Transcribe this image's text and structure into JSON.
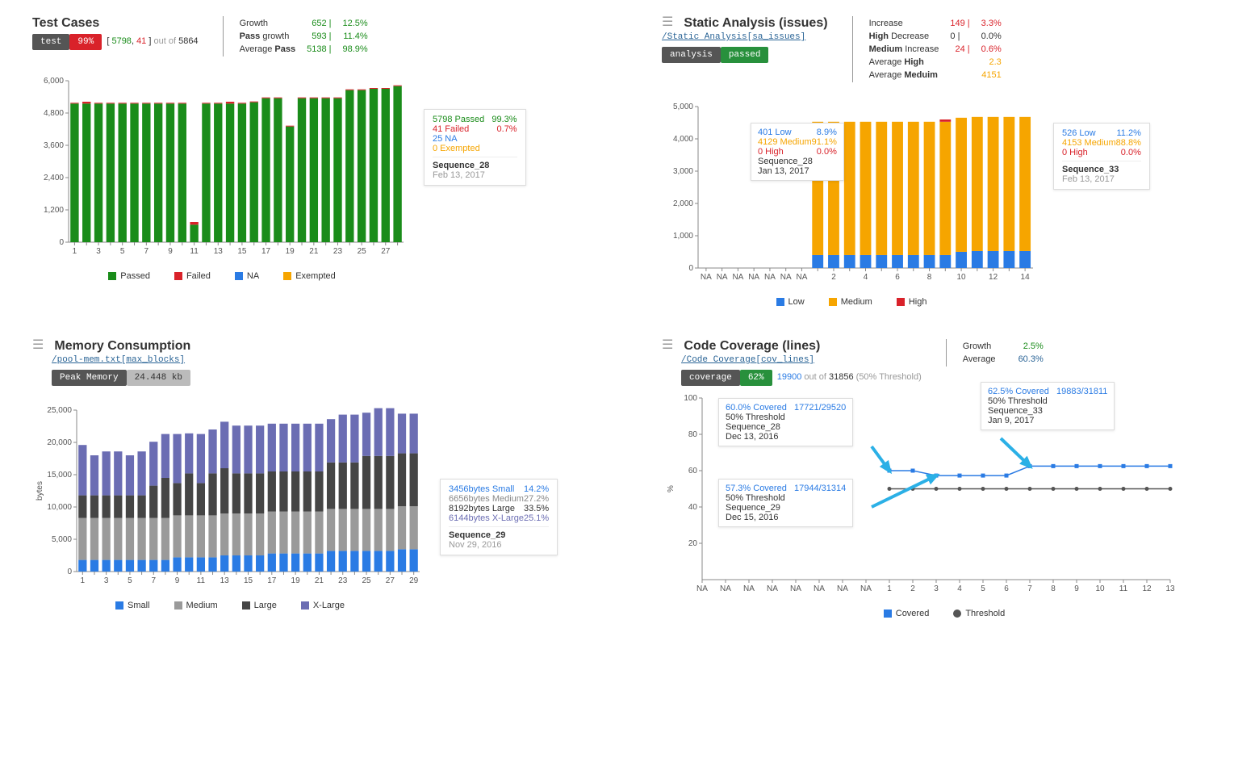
{
  "colors": {
    "pass": "#1a8c1a",
    "fail": "#d9222a",
    "na": "#2a7be4",
    "exempt": "#f6a500",
    "low": "#2a7be4",
    "medium": "#f6a500",
    "high": "#d9222a",
    "small": "#2a7be4",
    "mediumGray": "#9a9a9a",
    "large": "#454545",
    "xlarge": "#6b6db3",
    "covered": "#2a7be4",
    "threshold": "#555"
  },
  "testCases": {
    "title": "Test Cases",
    "badges": {
      "label": "test",
      "pct": "99%"
    },
    "summary": {
      "pass": "5798",
      "fail": "41",
      "outof": "out of",
      "total": "5864"
    },
    "stats": [
      {
        "label": "Growth",
        "val": "652 |",
        "pct": "12.5%"
      },
      {
        "labelA": "Pass",
        "labelB": " growth",
        "val": "593 |",
        "pct": "11.4%"
      },
      {
        "labelA": "Average ",
        "labelB": "Pass",
        "val": "5138 |",
        "pct": "98.9%"
      }
    ],
    "legend": [
      "Passed",
      "Failed",
      "NA",
      "Exempted"
    ],
    "side": {
      "passed": "5798 Passed",
      "passedPct": "99.3%",
      "failed": "41 Failed",
      "failedPct": "0.7%",
      "na": "25 NA",
      "exempt": "0 Exempted",
      "seq": "Sequence_28",
      "date": "Feb 13, 2017"
    }
  },
  "staticAnalysis": {
    "title": "Static Analysis (issues)",
    "link": "/Static Analysis[sa_issues]",
    "badges": {
      "label": "analysis",
      "status": "passed"
    },
    "stats": [
      {
        "label": "Increase",
        "val": "149 |",
        "pct": "3.3%",
        "cls": "num-red"
      },
      {
        "labelA": "High ",
        "labelB": "Decrease",
        "val": "0 |",
        "pct": "0.0%",
        "cls": ""
      },
      {
        "labelA": "Medium ",
        "labelB": "Increase",
        "val": "24 |",
        "pct": "0.6%",
        "cls": "num-red"
      },
      {
        "labelA": "Average ",
        "labelB": "High",
        "val": "",
        "pct": "2.3",
        "cls": "num-orange"
      },
      {
        "labelA": "Average ",
        "labelB": "Meduim",
        "val": "",
        "pct": "4151",
        "cls": "num-orange"
      }
    ],
    "legend": [
      "Low",
      "Medium",
      "High"
    ],
    "call1": {
      "low": "401 Low",
      "lowp": "8.9%",
      "med": "4129 Medium",
      "medp": "91.1%",
      "high": "0 High",
      "highp": "0.0%",
      "seq": "Sequence_28",
      "date": "Jan 13, 2017"
    },
    "call2": {
      "low": "526 Low",
      "lowp": "11.2%",
      "med": "4153 Medium",
      "medp": "88.8%",
      "high": "0 High",
      "highp": "0.0%",
      "seq": "Sequence_33",
      "date": "Feb 13, 2017"
    }
  },
  "memory": {
    "title": "Memory Consumption",
    "link": "/pool-mem.txt[max_blocks]",
    "badges": {
      "label": "Peak Memory",
      "val": "24.448 kb"
    },
    "legend": [
      "Small",
      "Medium",
      "Large",
      "X-Large"
    ],
    "ylab": "bytes",
    "side": {
      "small": "3456bytes Small",
      "smallp": "14.2%",
      "medium": "6656bytes Medium",
      "mediump": "27.2%",
      "large": "8192bytes Large",
      "largep": "33.5%",
      "xlarge": "6144bytes X-Large",
      "xlargep": "25.1%",
      "seq": "Sequence_29",
      "date": "Nov 29, 2016"
    }
  },
  "coverage": {
    "title": "Code Coverage (lines)",
    "link": "/Code Coverage[cov_lines]",
    "badges": {
      "label": "coverage",
      "pct": "62%"
    },
    "summary": {
      "num": "19900",
      "outof": "out of",
      "total": "31856",
      "thr": "(50% Threshold)"
    },
    "stats": [
      {
        "label": "Growth",
        "pct": "2.5%",
        "cls": "num-green"
      },
      {
        "label": "Average",
        "pct": "60.3%",
        "cls": "num-blue"
      }
    ],
    "legend": [
      "Covered",
      "Threshold"
    ],
    "ylab": "%",
    "calls": {
      "a": {
        "head": "60.0% Covered",
        "frac": "17721/29520",
        "thr": "50% Threshold",
        "seq": "Sequence_28",
        "date": "Dec 13, 2016"
      },
      "b": {
        "head": "57.3% Covered",
        "frac": "17944/31314",
        "thr": "50% Threshold",
        "seq": "Sequence_29",
        "date": "Dec 15, 2016"
      },
      "c": {
        "head": "62.5% Covered",
        "frac": "19883/31811",
        "thr": "50% Threshold",
        "seq": "Sequence_33",
        "date": "Jan 9, 2017"
      }
    }
  },
  "chart_data": [
    {
      "id": "test_cases",
      "type": "bar",
      "title": "Test Cases",
      "categories": [
        1,
        2,
        3,
        4,
        5,
        6,
        7,
        8,
        9,
        10,
        11,
        12,
        13,
        14,
        15,
        16,
        17,
        18,
        19,
        20,
        21,
        22,
        23,
        24,
        25,
        26,
        27,
        28
      ],
      "ylim": [
        0,
        6000
      ],
      "series": [
        {
          "name": "Passed",
          "color": "#1a8c1a",
          "values": [
            5150,
            5150,
            5150,
            5150,
            5150,
            5150,
            5150,
            5150,
            5150,
            5150,
            650,
            5150,
            5150,
            5150,
            5150,
            5200,
            5350,
            5350,
            4300,
            5350,
            5350,
            5350,
            5350,
            5650,
            5650,
            5700,
            5700,
            5800
          ]
        },
        {
          "name": "Failed",
          "color": "#d9222a",
          "values": [
            30,
            70,
            30,
            30,
            30,
            30,
            30,
            30,
            30,
            30,
            100,
            30,
            30,
            70,
            30,
            30,
            30,
            30,
            30,
            30,
            30,
            30,
            30,
            30,
            30,
            30,
            30,
            30
          ]
        },
        {
          "name": "NA",
          "color": "#2a7be4",
          "values": [
            0,
            0,
            0,
            0,
            0,
            0,
            0,
            0,
            0,
            0,
            0,
            0,
            0,
            0,
            0,
            0,
            0,
            0,
            0,
            0,
            0,
            0,
            0,
            0,
            0,
            0,
            0,
            0
          ]
        },
        {
          "name": "Exempted",
          "color": "#f6a500",
          "values": [
            0,
            0,
            0,
            0,
            0,
            0,
            0,
            0,
            0,
            0,
            0,
            0,
            0,
            0,
            0,
            0,
            0,
            0,
            0,
            0,
            0,
            0,
            0,
            0,
            0,
            0,
            0,
            0
          ]
        }
      ]
    },
    {
      "id": "static_analysis",
      "type": "bar",
      "title": "Static Analysis (issues)",
      "categories": [
        "NA",
        "NA",
        "NA",
        "NA",
        "NA",
        "NA",
        "NA",
        1,
        2,
        3,
        4,
        5,
        6,
        7,
        8,
        9,
        10,
        11,
        12,
        13,
        14
      ],
      "ylim": [
        0,
        5000
      ],
      "series": [
        {
          "name": "Low",
          "color": "#2a7be4",
          "values": [
            0,
            0,
            0,
            0,
            0,
            0,
            0,
            401,
            401,
            401,
            401,
            401,
            401,
            401,
            401,
            401,
            501,
            526,
            526,
            526,
            526
          ]
        },
        {
          "name": "Medium",
          "color": "#f6a500",
          "values": [
            0,
            0,
            0,
            0,
            0,
            0,
            0,
            4129,
            4129,
            4129,
            4129,
            4129,
            4129,
            4129,
            4129,
            4129,
            4153,
            4153,
            4153,
            4153,
            4153
          ]
        },
        {
          "name": "High",
          "color": "#d9222a",
          "values": [
            0,
            0,
            0,
            0,
            0,
            0,
            0,
            0,
            0,
            0,
            0,
            0,
            0,
            0,
            0,
            70,
            0,
            0,
            0,
            0,
            0
          ]
        }
      ]
    },
    {
      "id": "memory",
      "type": "bar",
      "title": "Memory Consumption",
      "ylabel": "bytes",
      "categories": [
        1,
        2,
        3,
        4,
        5,
        6,
        7,
        8,
        9,
        10,
        11,
        12,
        13,
        14,
        15,
        16,
        17,
        18,
        19,
        20,
        21,
        22,
        23,
        24,
        25,
        26,
        27,
        28,
        29
      ],
      "ylim": [
        0,
        25000
      ],
      "series": [
        {
          "name": "Small",
          "color": "#2a7be4",
          "values": [
            1800,
            1800,
            1800,
            1800,
            1800,
            1800,
            1800,
            1800,
            2200,
            2200,
            2200,
            2200,
            2500,
            2500,
            2500,
            2500,
            2800,
            2800,
            2800,
            2800,
            2800,
            3200,
            3200,
            3200,
            3200,
            3200,
            3200,
            3456,
            3456
          ]
        },
        {
          "name": "Medium",
          "color": "#9a9a9a",
          "values": [
            6500,
            6500,
            6500,
            6500,
            6500,
            6500,
            6500,
            6500,
            6500,
            6500,
            6500,
            6500,
            6500,
            6500,
            6500,
            6500,
            6500,
            6500,
            6500,
            6500,
            6500,
            6500,
            6500,
            6500,
            6500,
            6500,
            6500,
            6656,
            6656
          ]
        },
        {
          "name": "Large",
          "color": "#454545",
          "values": [
            3500,
            3500,
            3500,
            3500,
            3500,
            3500,
            5000,
            6200,
            5000,
            6500,
            5000,
            6500,
            7000,
            6200,
            6200,
            6200,
            6200,
            6200,
            6200,
            6200,
            6200,
            7200,
            7200,
            7200,
            8200,
            8200,
            8200,
            8192,
            8192
          ]
        },
        {
          "name": "X-Large",
          "color": "#6b6db3",
          "values": [
            7800,
            6200,
            6800,
            6800,
            6200,
            6800,
            6800,
            6800,
            7600,
            6200,
            7600,
            6800,
            7200,
            7400,
            7400,
            7400,
            7400,
            7400,
            7400,
            7400,
            7400,
            6700,
            7400,
            7400,
            6700,
            7400,
            7400,
            6144,
            6144
          ]
        }
      ]
    },
    {
      "id": "coverage",
      "type": "line",
      "title": "Code Coverage (lines)",
      "ylabel": "%",
      "x": [
        "NA",
        "NA",
        "NA",
        "NA",
        "NA",
        "NA",
        "NA",
        "NA",
        1,
        2,
        3,
        4,
        5,
        6,
        7,
        8,
        9,
        10,
        11,
        12,
        13
      ],
      "ylim": [
        0,
        100
      ],
      "series": [
        {
          "name": "Covered",
          "color": "#2a7be4",
          "values": [
            null,
            null,
            null,
            null,
            null,
            null,
            null,
            null,
            60.0,
            60.0,
            57.3,
            57.3,
            57.3,
            57.3,
            62.5,
            62.5,
            62.5,
            62.5,
            62.5,
            62.5,
            62.5
          ]
        },
        {
          "name": "Threshold",
          "color": "#555",
          "values": [
            null,
            null,
            null,
            null,
            null,
            null,
            null,
            null,
            50,
            50,
            50,
            50,
            50,
            50,
            50,
            50,
            50,
            50,
            50,
            50,
            50
          ]
        }
      ]
    }
  ]
}
